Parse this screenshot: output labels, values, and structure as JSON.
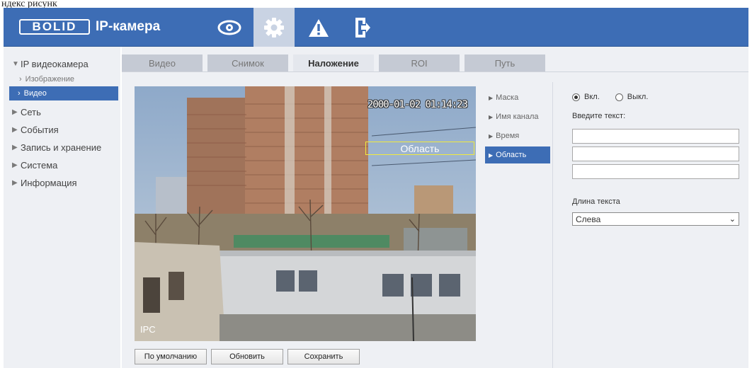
{
  "caption": "ндекс рисунк",
  "header": {
    "logo_brand": "BOLID",
    "logo_text": "IP-камера",
    "icons": [
      "eye-icon",
      "gear-icon",
      "warning-icon",
      "logout-icon"
    ]
  },
  "sidebar": {
    "items": [
      {
        "label": "IP видеокамера",
        "arrow": "▼"
      },
      {
        "label": "Изображение",
        "arrow": "›"
      },
      {
        "label": "Видео",
        "arrow": "›"
      },
      {
        "label": "Сеть",
        "arrow": "▶"
      },
      {
        "label": "События",
        "arrow": "▶"
      },
      {
        "label": "Запись и хранение",
        "arrow": "▶"
      },
      {
        "label": "Система",
        "arrow": "▶"
      },
      {
        "label": "Информация",
        "arrow": "▶"
      }
    ]
  },
  "tabs": [
    "Видео",
    "Снимок",
    "Наложение",
    "ROI",
    "Путь"
  ],
  "video": {
    "timestamp": "2000-01-02 01:14:23",
    "area_label": "Область",
    "channel_label": "IPC"
  },
  "submenu": {
    "items": [
      "Маска",
      "Имя канала",
      "Время",
      "Область"
    ],
    "marker": "▶"
  },
  "panel": {
    "radio_on": "Вкл.",
    "radio_off": "Выкл.",
    "enter_text_label": "Введите текст:",
    "inputs": [
      "",
      "",
      ""
    ],
    "length_label": "Длина текста",
    "select_value": "Слева",
    "select_chevron": "⌄"
  },
  "buttons": {
    "default": "По умолчанию",
    "refresh": "Обновить",
    "save": "Сохранить"
  },
  "colors": {
    "header": "#3d6db5",
    "active_item": "#3d6db5",
    "osd_frame": "#f2ea3c"
  }
}
